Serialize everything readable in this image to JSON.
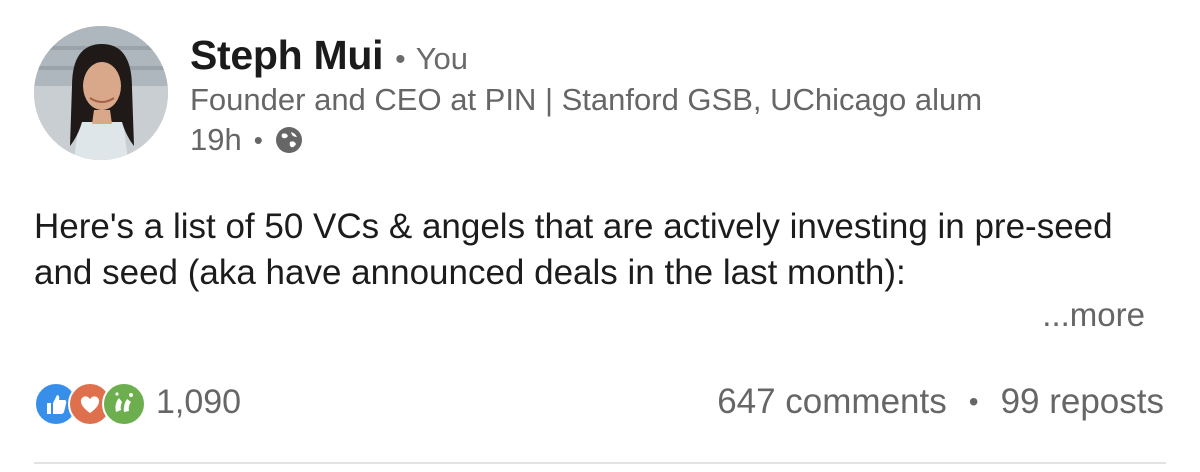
{
  "post": {
    "author": {
      "name": "Steph Mui",
      "relation": "You",
      "headline": "Founder and CEO at PIN | Stanford GSB, UChicago alum",
      "time": "19h",
      "visibility_icon": "globe-icon"
    },
    "text": "Here's a list of 50 VCs & angels that are actively investing in pre-seed and seed (aka have announced deals in the last month):",
    "more_label": "...more",
    "reactions": {
      "icons": [
        "like-icon",
        "love-icon",
        "celebrate-icon"
      ],
      "count": "1,090"
    },
    "comments_label": "647 comments",
    "reposts_label": "99 reposts"
  },
  "colors": {
    "like": "#378fe9",
    "love": "#df704d",
    "celebrate": "#6dae4f",
    "secondary_text": "#666666"
  }
}
